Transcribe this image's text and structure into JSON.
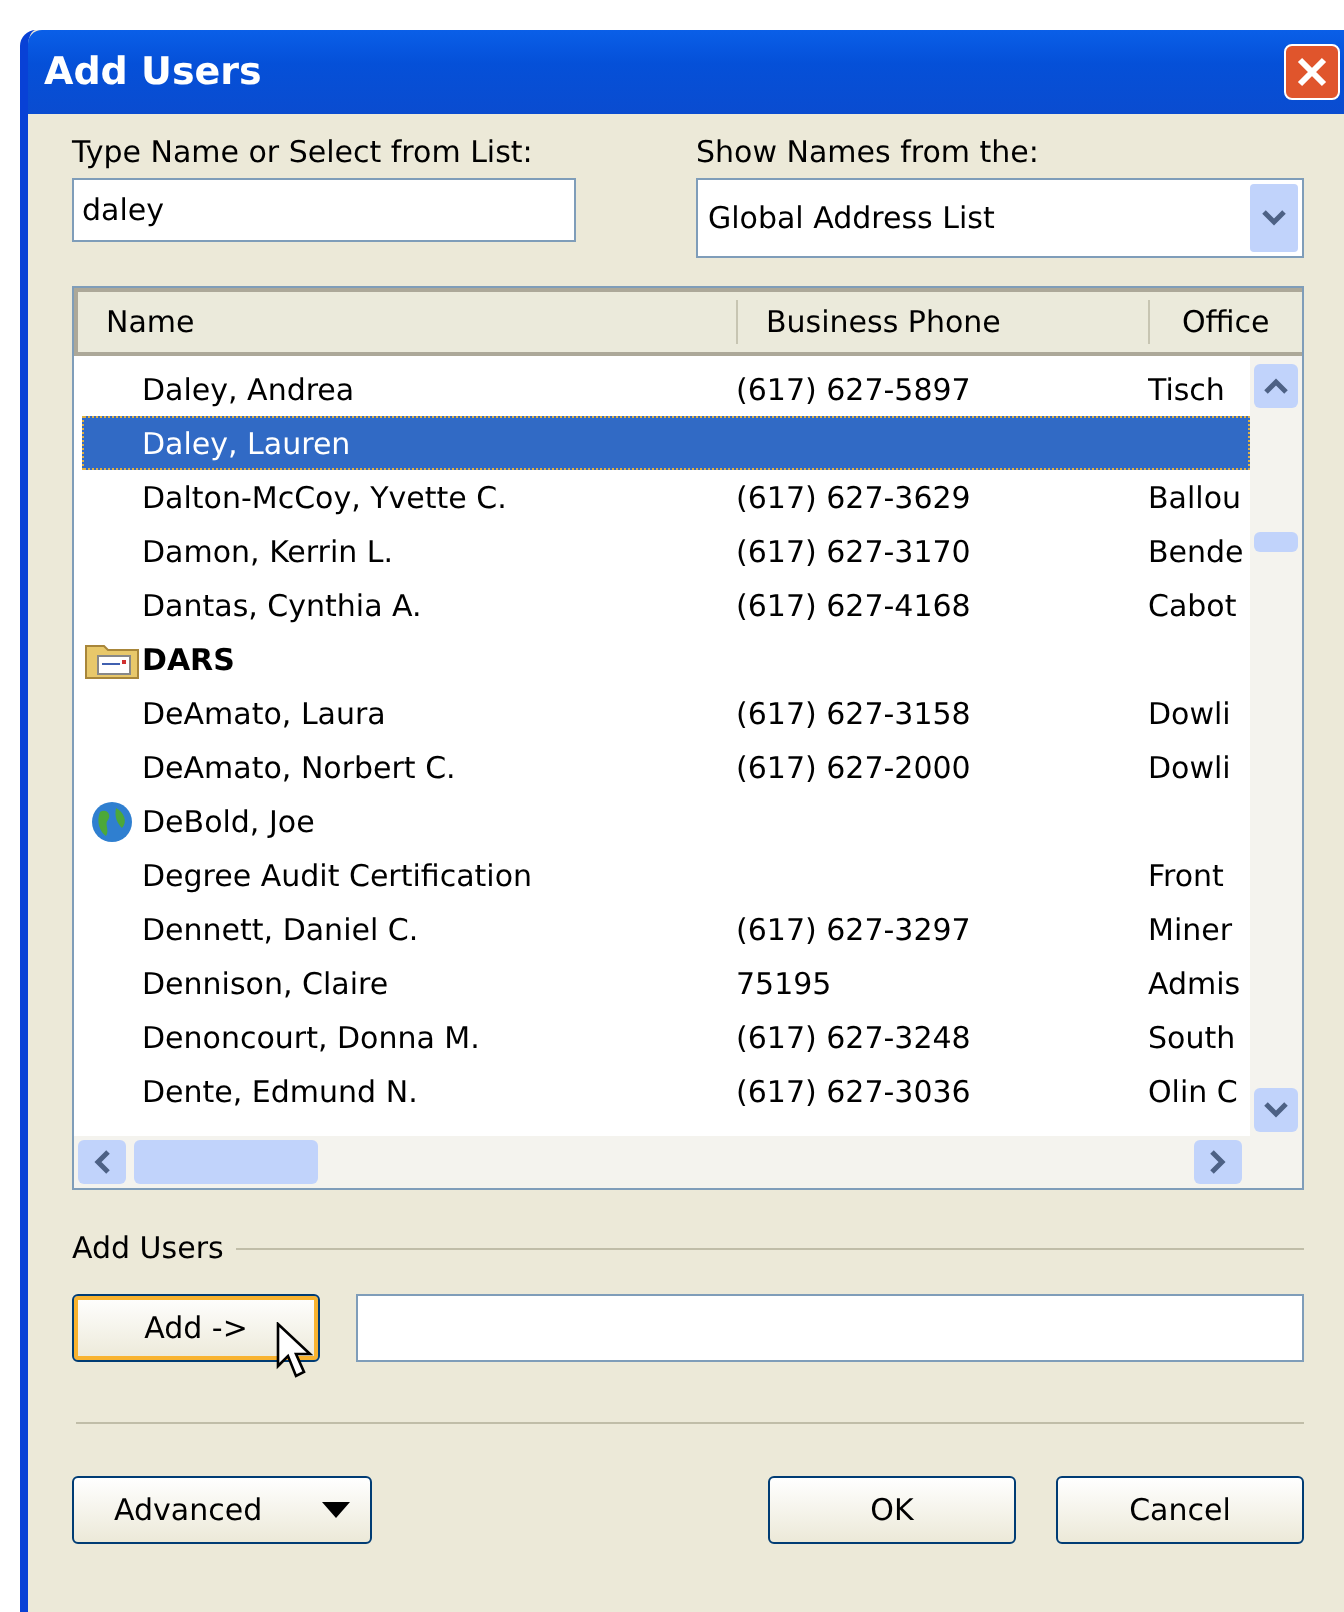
{
  "window": {
    "title": "Add Users"
  },
  "name_field": {
    "label": "Type Name or Select from List:",
    "value": "daley"
  },
  "source": {
    "label": "Show Names from the:",
    "value": "Global Address List"
  },
  "table": {
    "columns": [
      "Name",
      "Business Phone",
      "Office"
    ],
    "rows": [
      {
        "kind": "person",
        "name": "Daley, Andrea",
        "phone": "(617) 627-5897",
        "office": "Tisch",
        "selected": false
      },
      {
        "kind": "person",
        "name": "Daley, Lauren",
        "selected": true
      },
      {
        "kind": "person",
        "name": "Dalton-McCoy, Yvette C.",
        "phone": "(617) 627-3629",
        "office": "Ballou",
        "selected": false
      },
      {
        "kind": "person",
        "name": "Damon, Kerrin L.",
        "phone": "(617) 627-3170",
        "office": "Bende",
        "selected": false
      },
      {
        "kind": "person",
        "name": "Dantas, Cynthia A.",
        "phone": "(617) 627-4168",
        "office": "Cabot",
        "selected": false
      },
      {
        "kind": "group",
        "name": "DARS",
        "selected": false
      },
      {
        "kind": "person",
        "name": "DeAmato, Laura",
        "phone": "(617) 627-3158",
        "office": "Dowli",
        "selected": false
      },
      {
        "kind": "person",
        "name": "DeAmato, Norbert C.",
        "phone": "(617) 627-2000",
        "office": "Dowli",
        "selected": false
      },
      {
        "kind": "public",
        "name": "DeBold, Joe",
        "selected": false
      },
      {
        "kind": "person",
        "name": "Degree Audit Certification",
        "office": "Front",
        "selected": false
      },
      {
        "kind": "person",
        "name": "Dennett, Daniel C.",
        "phone": "(617) 627-3297",
        "office": "Miner",
        "selected": false
      },
      {
        "kind": "person",
        "name": "Dennison, Claire",
        "phone": "75195",
        "office": "Admis",
        "selected": false
      },
      {
        "kind": "person",
        "name": "Denoncourt, Donna M.",
        "phone": "(617) 627-3248",
        "office": "South",
        "selected": false
      },
      {
        "kind": "person",
        "name": "Dente, Edmund N.",
        "phone": "(617) 627-3036",
        "office": "Olin C",
        "selected": false
      }
    ]
  },
  "add_users": {
    "label": "Add Users",
    "button": "Add ->"
  },
  "buttons": {
    "advanced": "Advanced",
    "ok": "OK",
    "cancel": "Cancel"
  }
}
